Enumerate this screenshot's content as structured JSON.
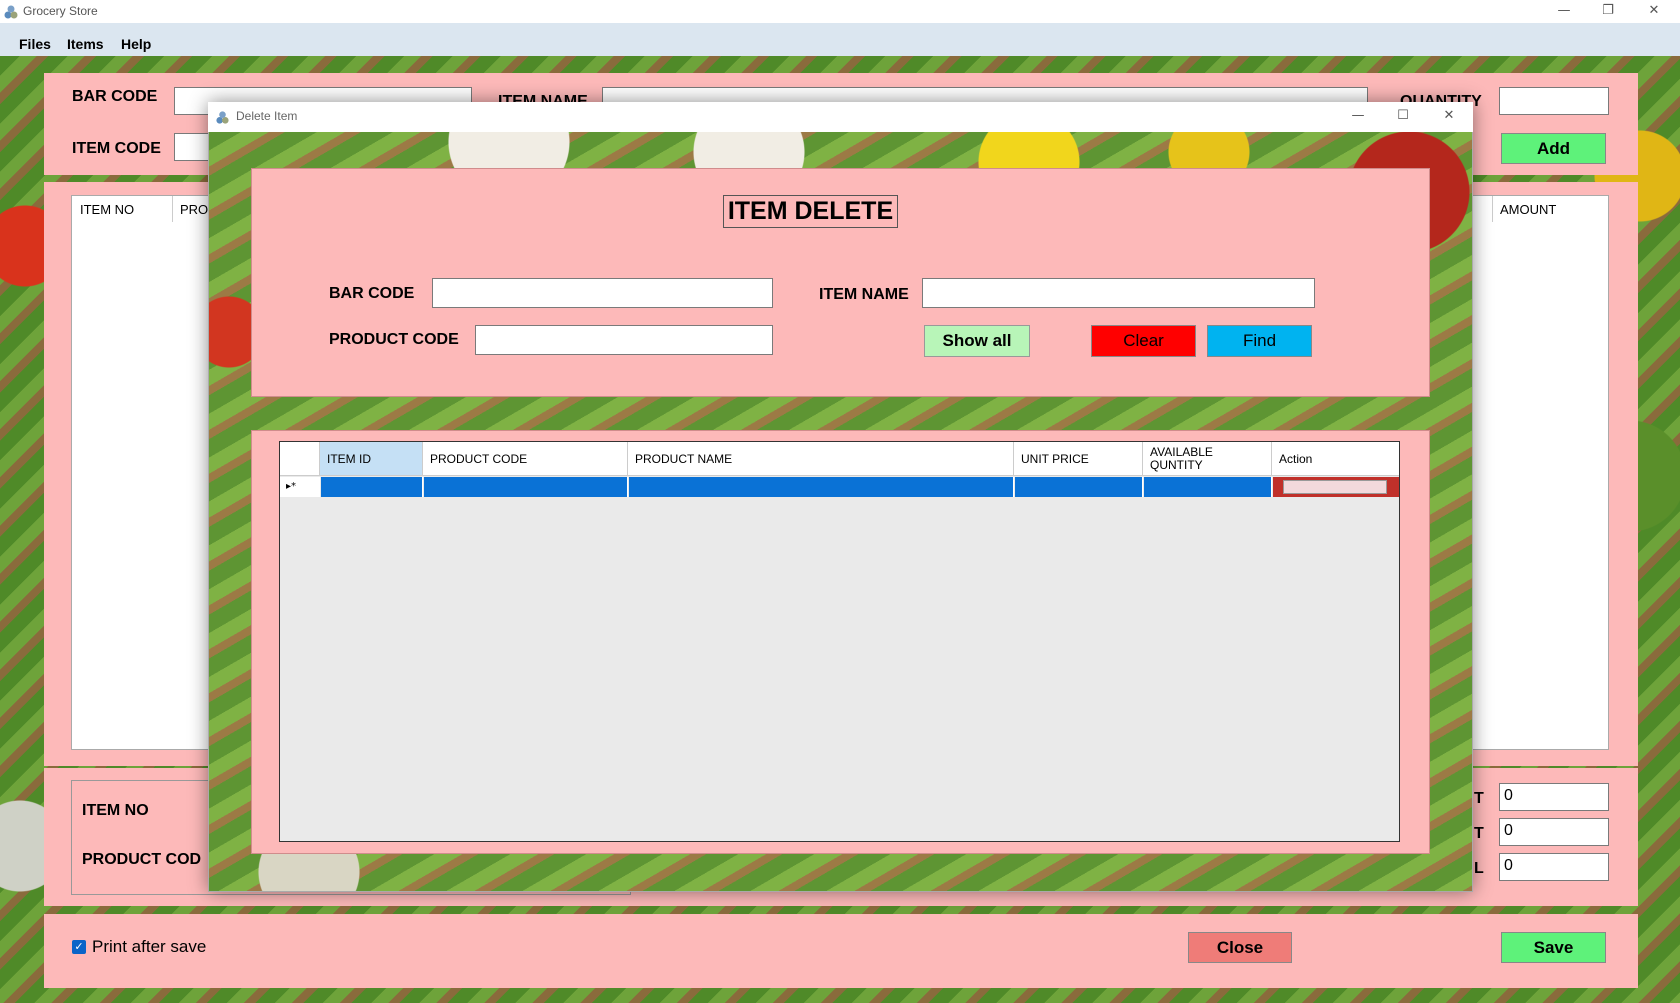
{
  "app": {
    "title": "Grocery Store",
    "icon": "app-icon"
  },
  "window_controls": {
    "minimize": "—",
    "restore": "❐",
    "close": "✕"
  },
  "menu": {
    "files": "Files",
    "items": "Items",
    "help": "Help"
  },
  "main": {
    "bar_code_label": "BAR CODE",
    "item_code_label": "ITEM CODE",
    "item_name_label": "ITEM NAME",
    "quantity_label": "QUANTITY",
    "add_button": "Add",
    "list_columns": {
      "item_no": "ITEM NO",
      "product": "PRO",
      "amount": "AMOUNT"
    },
    "detail": {
      "item_no_label": "ITEM NO",
      "product_code_label": "PRODUCT COD"
    },
    "totals": {
      "label1": "T",
      "value1": "0",
      "label2": "T",
      "value2": "0",
      "label3": "L",
      "value3": "0"
    },
    "print_after_save_label": "Print after save",
    "print_after_save_checked": true,
    "close_button": "Close",
    "save_button": "Save"
  },
  "dialog": {
    "title": "Delete Item",
    "heading": "ITEM DELETE",
    "bar_code_label": "BAR CODE",
    "item_name_label": "ITEM NAME",
    "product_code_label": "PRODUCT CODE",
    "bar_code_value": "",
    "item_name_value": "",
    "product_code_value": "",
    "show_all_button": "Show all",
    "clear_button": "Clear",
    "find_button": "Find",
    "grid": {
      "columns": [
        "ITEM ID",
        "PRODUCT CODE",
        "PRODUCT NAME",
        "UNIT PRICE",
        "AVAILABLE QUNTITY",
        "Action"
      ],
      "new_row_marker": "▸*"
    }
  },
  "colors": {
    "panel": "#fdb9b9",
    "add_save": "#5ef27a",
    "clear": "#ff0000",
    "find": "#00b3f0",
    "show_all": "#b8f5b8",
    "close": "#ef7c78",
    "selection": "#0a72d6"
  }
}
